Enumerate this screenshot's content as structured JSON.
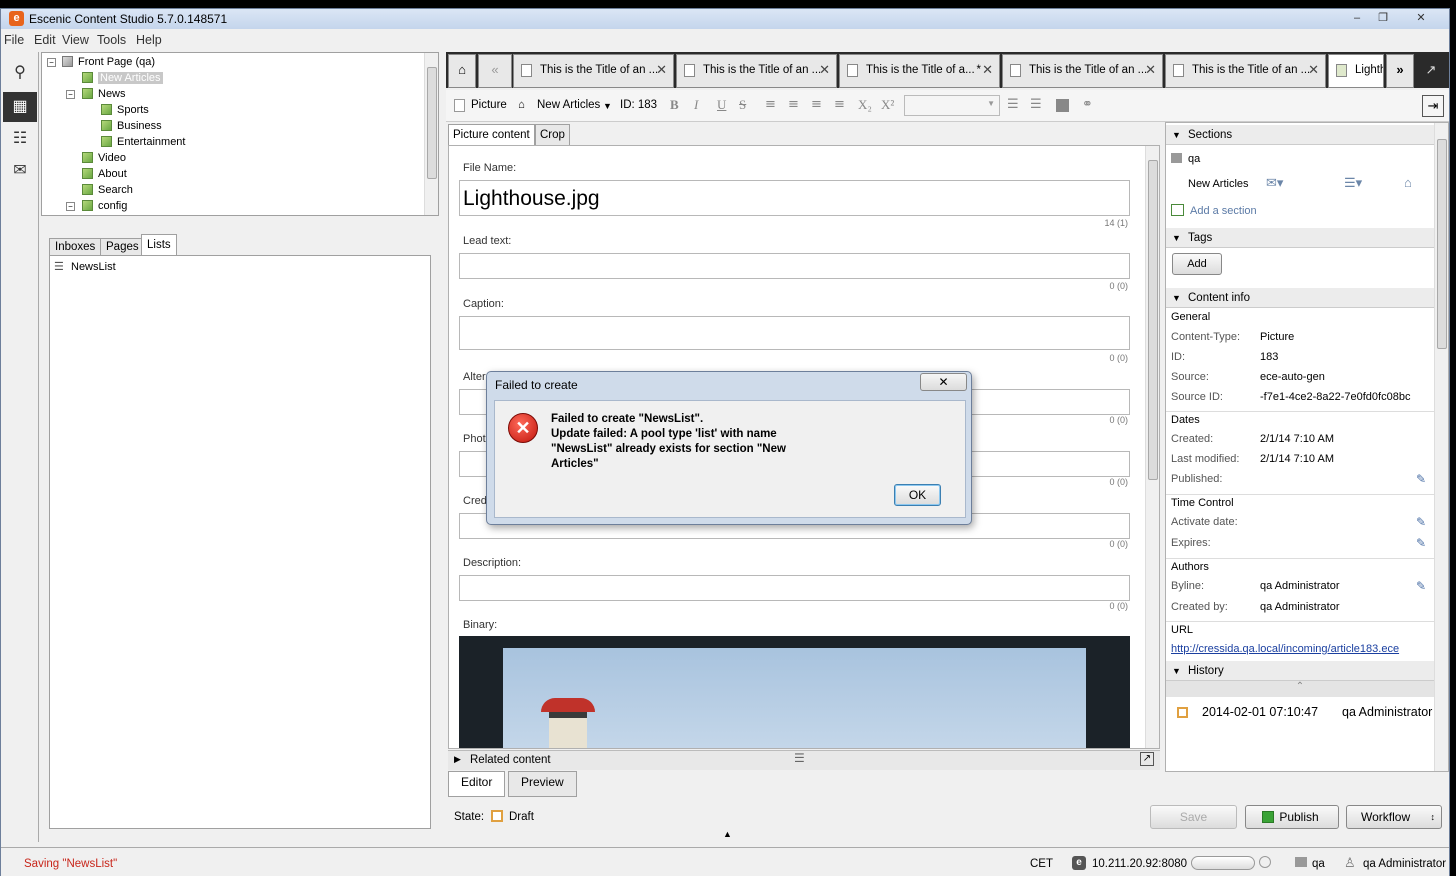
{
  "window": {
    "title": "Escenic Content Studio 5.7.0.148571",
    "minimize": "–",
    "maximize": "❐",
    "close": "✕"
  },
  "menu": [
    "File",
    "Edit",
    "View",
    "Tools",
    "Help"
  ],
  "tree": {
    "root": "Front Page (qa)",
    "items": [
      "New Articles",
      "News",
      "Sports",
      "Business",
      "Entertainment",
      "Video",
      "About",
      "Search",
      "config"
    ]
  },
  "left_tabs": [
    "Inboxes",
    "Pages",
    "Lists"
  ],
  "lists": [
    "NewsList"
  ],
  "doc_tabs": [
    "This is the Title of an ...",
    "This is the Title of an ...",
    "This is the Title of a...",
    "This is the Title of an ...",
    "This is the Title of an ...",
    "Lighth"
  ],
  "doc_tab_dirty_marker": "*",
  "toolbar": {
    "type": "Picture",
    "section": "New Articles",
    "id": "ID: 183",
    "formats": [
      "B",
      "I",
      "U",
      "S"
    ],
    "sub": "X₂",
    "sup": "X²"
  },
  "form_tabs": [
    "Picture content",
    "Crop"
  ],
  "form": {
    "file_name_label": "File Name:",
    "file_name_value": "Lighthouse.jpg",
    "file_name_count": "14 (1)",
    "lead_label": "Lead text:",
    "lead_count": "0 (0)",
    "caption_label": "Caption:",
    "caption_count": "0 (0)",
    "alt_label": "Alter",
    "alt_count": "0 (0)",
    "photo_label": "Phot",
    "photo_count": "0 (0)",
    "credit_label": "Cred",
    "credit_count": "0 (0)",
    "description_label": "Description:",
    "description_count": "0 (0)",
    "binary_label": "Binary:"
  },
  "related": "Related content",
  "bottom_tabs": [
    "Editor",
    "Preview"
  ],
  "state": {
    "label": "State:",
    "value": "Draft"
  },
  "actions": {
    "save": "Save",
    "publish": "Publish",
    "workflow": "Workflow"
  },
  "sidebar": {
    "sections_title": "Sections",
    "section_owner": "qa",
    "section_name": "New Articles",
    "add_section": "Add a section",
    "tags_title": "Tags",
    "tags_add": "Add",
    "content_info_title": "Content info",
    "general": "General",
    "content_type_label": "Content-Type:",
    "content_type": "Picture",
    "id_label": "ID:",
    "id": "183",
    "source_label": "Source:",
    "source": "ece-auto-gen",
    "source_id_label": "Source ID:",
    "source_id": "-f7e1-4ce2-8a22-7e0fd0fc08bc",
    "dates": "Dates",
    "created_label": "Created:",
    "created": "2/1/14 7:10 AM",
    "modified_label": "Last modified:",
    "modified": "2/1/14 7:10 AM",
    "published_label": "Published:",
    "time_control": "Time Control",
    "activate_label": "Activate date:",
    "expires_label": "Expires:",
    "authors": "Authors",
    "byline_label": "Byline:",
    "byline": "qa Administrator",
    "created_by_label": "Created by:",
    "created_by": "qa Administrator",
    "url_title": "URL",
    "url": "http://cressida.qa.local/incoming/article183.ece",
    "history_title": "History",
    "history_date": "2014-02-01 07:10:47",
    "history_user": "qa Administrator"
  },
  "status": {
    "message": "Saving \"NewsList\"",
    "timezone": "CET",
    "server": "10.211.20.92:8080",
    "publication": "qa",
    "user": "qa Administrator"
  },
  "dialog": {
    "title": "Failed to create",
    "line1": "Failed to create \"NewsList\".",
    "line2": "Update failed: A pool type 'list' with name",
    "line3": "\"NewsList\" already exists for section \"New",
    "line4": "Articles\"",
    "ok": "OK",
    "close": "✕"
  }
}
